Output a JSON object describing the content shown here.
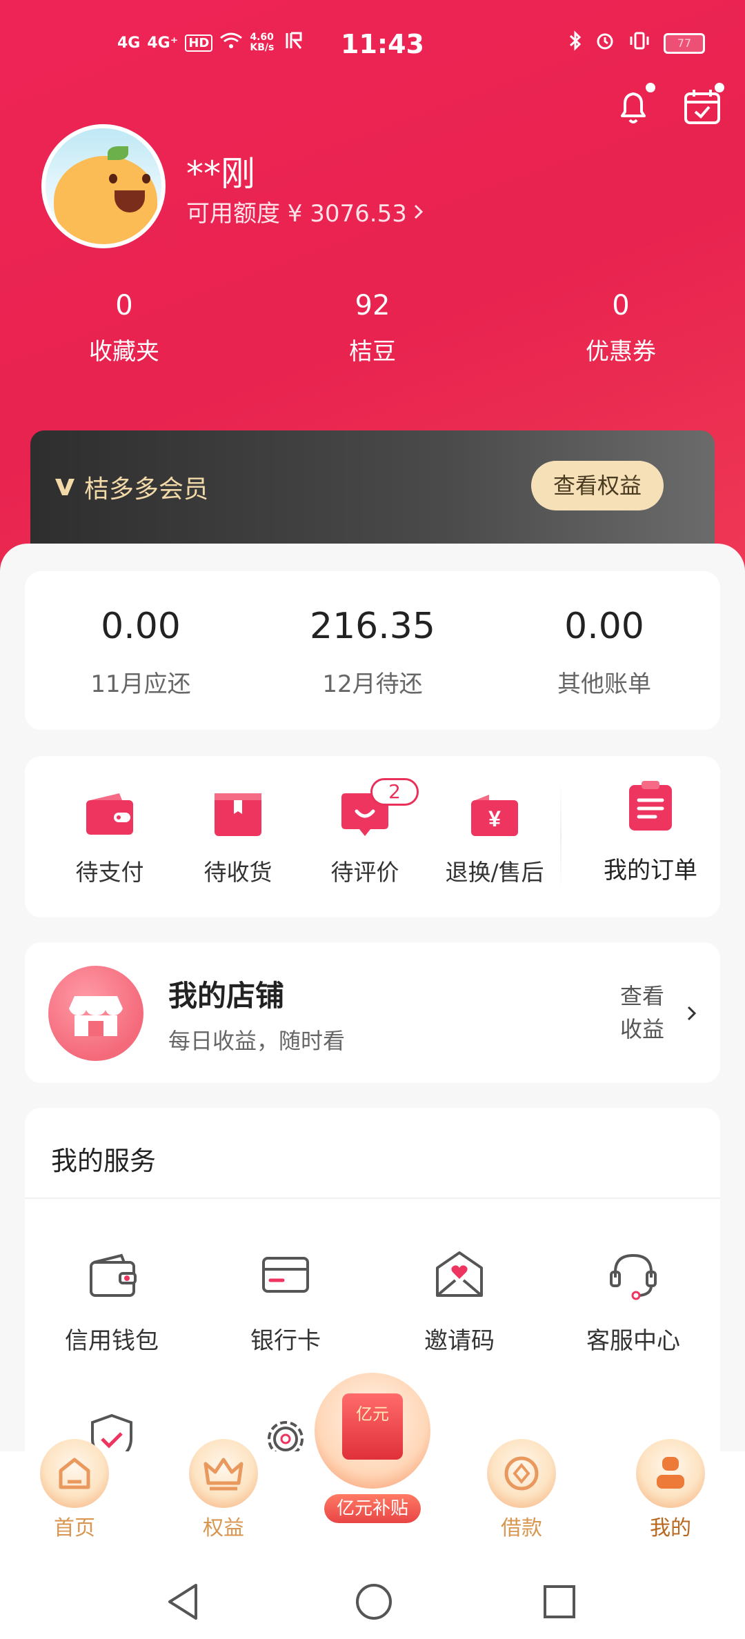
{
  "status_bar": {
    "signals": [
      "4G",
      "4G⁺",
      "HD"
    ],
    "net_speed": "4.60 KB/s",
    "time": "11:43",
    "battery": "77"
  },
  "profile": {
    "name": "**刚",
    "credit_label": "可用额度 ¥ 3076.53"
  },
  "stats": [
    {
      "value": "0",
      "label": "收藏夹"
    },
    {
      "value": "92",
      "label": "桔豆"
    },
    {
      "value": "0",
      "label": "优惠券"
    }
  ],
  "membership": {
    "title": "桔多多会员",
    "button": "查看权益"
  },
  "bills": [
    {
      "amount": "0.00",
      "label": "11月应还"
    },
    {
      "amount": "216.35",
      "label": "12月待还"
    },
    {
      "amount": "0.00",
      "label": "其他账单"
    }
  ],
  "orders": {
    "items": [
      {
        "label": "待支付",
        "icon": "wallet-icon"
      },
      {
        "label": "待收货",
        "icon": "package-icon"
      },
      {
        "label": "待评价",
        "icon": "chat-smile-icon",
        "badge": "2"
      },
      {
        "label": "退换/售后",
        "icon": "refund-icon"
      }
    ],
    "my_orders": "我的订单"
  },
  "shop": {
    "title": "我的店铺",
    "subtitle": "每日收益，随时看",
    "view_line1": "查看",
    "view_line2": "收益"
  },
  "services": {
    "title": "我的服务",
    "items": [
      {
        "label": "信用钱包",
        "icon": "credit-wallet-icon"
      },
      {
        "label": "银行卡",
        "icon": "bank-card-icon"
      },
      {
        "label": "邀请码",
        "icon": "invite-envelope-icon"
      },
      {
        "label": "客服中心",
        "icon": "headset-icon"
      }
    ]
  },
  "tabbar": {
    "items": [
      {
        "label": "首页",
        "icon": "home-icon"
      },
      {
        "label": "权益",
        "icon": "crown-icon"
      },
      {
        "label": "借款",
        "icon": "coin-icon"
      },
      {
        "label": "我的",
        "icon": "user-icon"
      }
    ],
    "center_top": "亿元",
    "center_label": "亿元补贴"
  },
  "colors": {
    "brand": "#e8234f",
    "gold": "#f5e0b8",
    "tab_text": "#d89650"
  }
}
